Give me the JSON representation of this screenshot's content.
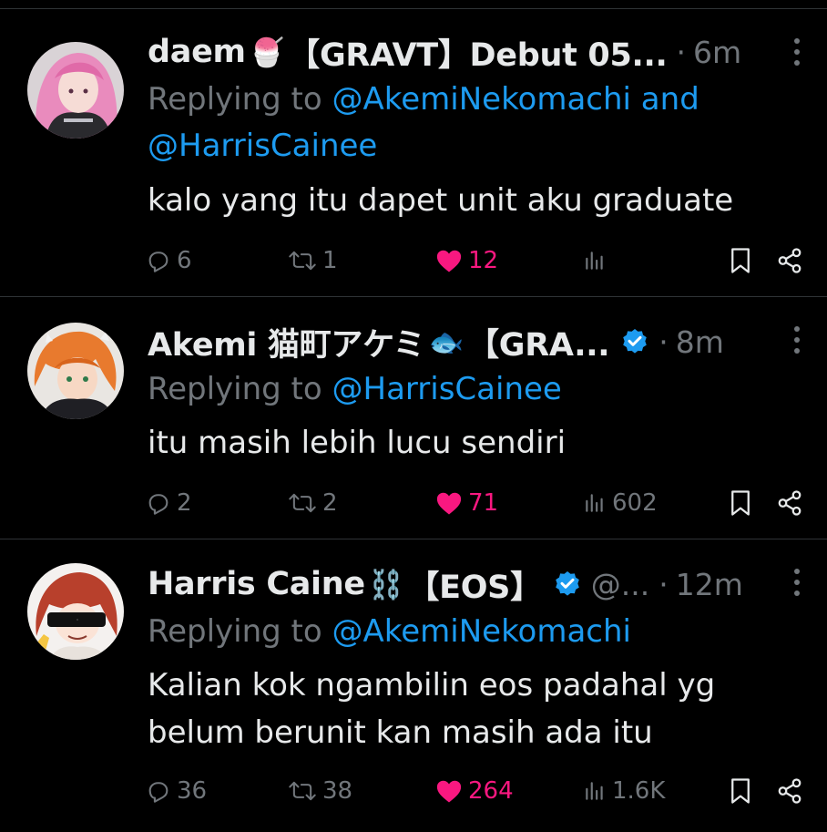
{
  "colors": {
    "background": "#000000",
    "text": "#e7e9ea",
    "muted": "#71767b",
    "mention": "#1d9bf0",
    "like": "#f91880",
    "verified": "#1d9bf0"
  },
  "replying_prefix": "Replying to ",
  "tweets": [
    {
      "name": "daem",
      "emoji": "🍧",
      "name_suffix": "【GRAVT】Debut 05...",
      "handle": "",
      "time": "6m",
      "verified": false,
      "mention_1": "@AkemiNekomachi",
      "mention_joiner": " and",
      "mention_2": "@HarrisCainee",
      "text": "kalo yang itu dapet unit aku graduate",
      "replies": "6",
      "reposts": "1",
      "likes": "12",
      "views": "",
      "icons": [
        "reply-icon",
        "repost-icon",
        "heart-filled-icon",
        "views-icon",
        "bookmark-icon",
        "share-icon"
      ]
    },
    {
      "name": "Akemi 猫町アケミ",
      "emoji": "🐟",
      "name_suffix": "【GRA...",
      "handle": "",
      "time": "8m",
      "verified": true,
      "mention_1": "@HarrisCainee",
      "text": "itu masih lebih lucu sendiri",
      "replies": "2",
      "reposts": "2",
      "likes": "71",
      "views": "602"
    },
    {
      "name": "Harris Caine",
      "emoji": "⛓️",
      "name_suffix": "【EOS】",
      "handle": "@...",
      "time": "12m",
      "verified": true,
      "mention_1": "@AkemiNekomachi",
      "text_line_1": "Kalian kok ngambilin eos padahal yg",
      "text_line_2": "belum berunit kan masih ada itu",
      "replies": "36",
      "reposts": "38",
      "likes": "264",
      "views": "1.6K"
    }
  ]
}
